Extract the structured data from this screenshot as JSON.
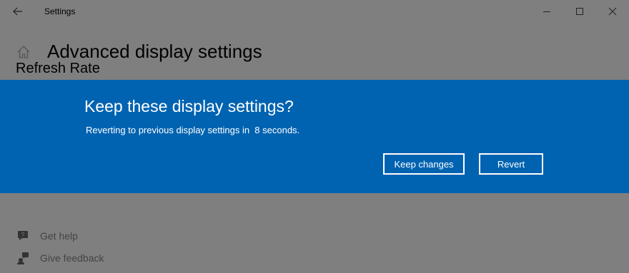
{
  "window": {
    "title": "Settings",
    "icons": {
      "back": "back-arrow-icon",
      "minimize": "minimize-icon",
      "maximize": "maximize-icon",
      "close": "close-icon"
    }
  },
  "page": {
    "title": "Advanced display settings",
    "section_peek": "Refresh Rate",
    "home_icon": "home-icon"
  },
  "dialog": {
    "title": "Keep these display settings?",
    "message": "Reverting to previous display settings in  8 seconds.",
    "keep_label": "Keep changes",
    "revert_label": "Revert",
    "background": "#0063b1"
  },
  "help": {
    "get_help": "Get help",
    "give_feedback": "Give feedback"
  }
}
